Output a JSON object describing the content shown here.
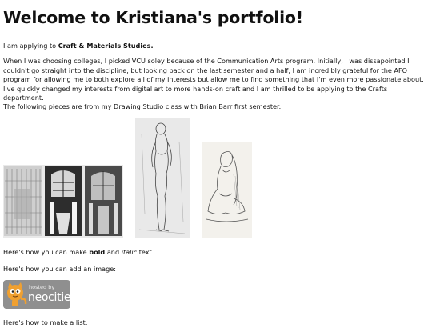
{
  "heading": "Welcome to Kristiana's portfolio!",
  "apply": {
    "prefix": "I am applying to ",
    "program": "Craft & Materials Studies."
  },
  "intro": "When I was choosing colleges, I picked VCU soley because of the Communication Arts program. Initially, I was dissapointed I couldn't go straight into the discipline, but looking back on the last semester and a half, I am incredibly grateful for the AFO program for allowing me to both explore all of my interests but allow me to find something that I'm even more passionate about. I've quickly changed my interests from digital art to more hands-on craft and I am thrilled to be applying to the Crafts department.",
  "pieces_intro": "The following pieces are from my Drawing Studio class with Brian Barr first semester.",
  "formatting": {
    "prefix": "Here's how you can make ",
    "bold": "bold",
    "middle": " and ",
    "italic": "italic",
    "suffix": " text."
  },
  "image_intro": "Here's how you can add an image:",
  "badge": {
    "hosted": "hosted by",
    "brand": "neocities"
  },
  "list_intro": "Here's how to make a list:",
  "colors": {
    "badge_bg": "#8f8f8f",
    "badge_cat": "#f0a030"
  }
}
